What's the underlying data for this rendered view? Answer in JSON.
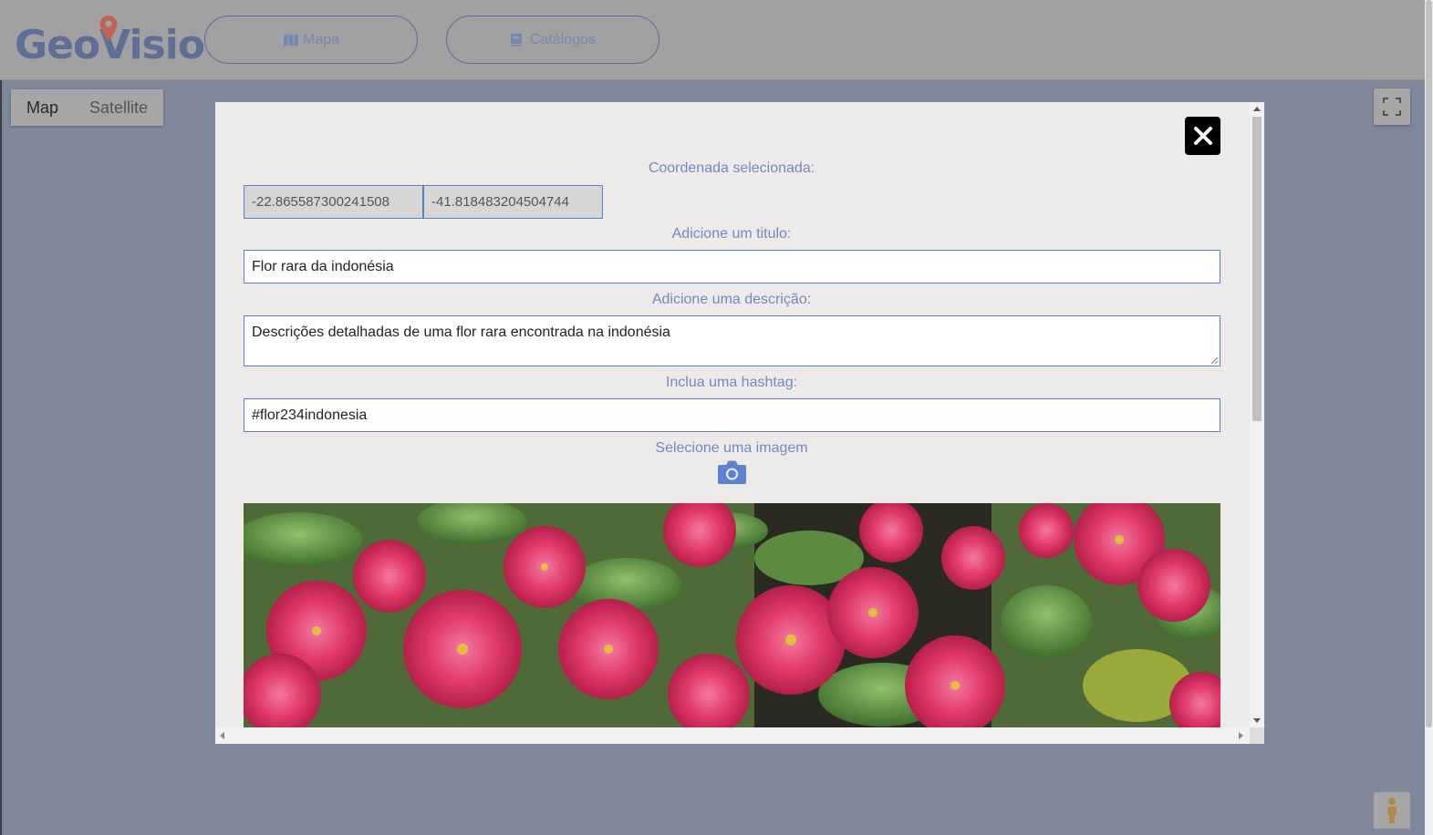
{
  "header": {
    "logo_text": "GeoVisio",
    "nav": [
      {
        "label": "Mapa",
        "icon": "map-icon"
      },
      {
        "label": "Catálogos",
        "icon": "book-icon"
      }
    ]
  },
  "map": {
    "type_buttons": [
      "Map",
      "Satellite"
    ],
    "selected_type": "Map"
  },
  "modal": {
    "coordinate_label": "Coordenada selecionada:",
    "latitude": "-22.865587300241508",
    "longitude": "-41.818483204504744",
    "title_label": "Adicione um titulo:",
    "title_value": "Flor rara da indonésia",
    "description_label": "Adicione uma descrição:",
    "description_value": "Descrições detalhadas de uma flor rara encontrada na indonésia",
    "hashtag_label": "Inclua uma hashtag:",
    "hashtag_value": "#flor234indonesia",
    "image_label": "Selecione uma imagem",
    "icons": [
      "close-icon",
      "camera-icon"
    ]
  },
  "colors": {
    "accent_label": "#7587c4",
    "input_border": "#5b7ed0",
    "logo": "#5d6f95",
    "pin": "#c0625a"
  }
}
